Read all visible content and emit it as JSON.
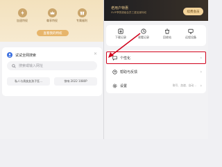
{
  "left": {
    "vip_card": {
      "perks": [
        {
          "icon": "bolt-icon",
          "label": "加速特权"
        },
        {
          "icon": "crown-icon",
          "label": "尊享特权"
        },
        {
          "icon": "gift-icon",
          "label": "专属福利"
        }
      ],
      "view_button": "查看我的特权"
    },
    "search_card": {
      "title": "试试全网搜索",
      "search_placeholder": "搜索或输入网址",
      "chips": [
        "私人与贵族女孩子狂...",
        "惊响 2022 1080P"
      ]
    }
  },
  "right": {
    "header": {
      "title": "老用户特惠",
      "subtitle": "SVIP享受超级会员三重加速特权",
      "renew_button": "续费会员"
    },
    "tools": [
      {
        "icon": "download-icon",
        "label": "下载记录"
      },
      {
        "icon": "clock-icon",
        "label": "观看记录"
      },
      {
        "icon": "recycle-bin-icon",
        "label": "回收站"
      },
      {
        "icon": "remote-download-icon",
        "label": "远程设备"
      }
    ],
    "menu": {
      "items": [
        {
          "label": "个性化",
          "sub": ""
        },
        {
          "label": "帮助与反馈",
          "sub": ""
        },
        {
          "label": "设置",
          "sub": "账号、加速、自动…"
        }
      ]
    }
  },
  "colors": {
    "highlight": "#d0021b",
    "gold": "#e7b56b",
    "brand_blue": "#3a6fe0"
  }
}
